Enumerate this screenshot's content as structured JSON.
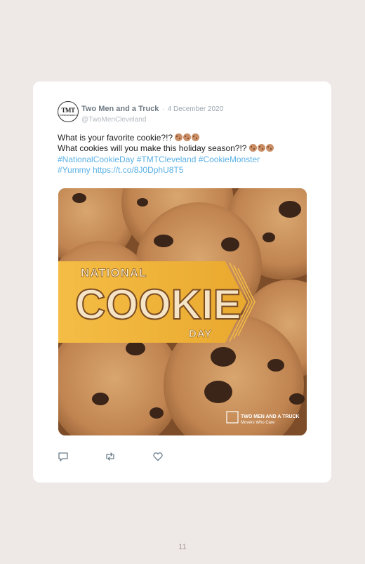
{
  "tweet": {
    "author_name": "Two Men and a Truck",
    "separator": "·",
    "date": "4 December 2020",
    "handle": "@TwoMenCleveland",
    "avatar_text": "TMT",
    "avatar_subtext": "TWO MEN AND A TRUCK",
    "text_line1": "What is your favorite cookie?!?",
    "text_line2": "What cookies will you make this holiday season?!?",
    "hashtag1": "#NationalCookieDay",
    "hashtag2": "#TMTCleveland",
    "hashtag3": "#CookieMonster",
    "hashtag4": "#Yummy",
    "short_link": "https://t.co/8J0DphU8T5",
    "emoji": "cookie-emoji"
  },
  "media": {
    "banner_line1": "NATIONAL",
    "banner_line2": "COOKIE",
    "banner_line3": "DAY",
    "watermark_brand": "TWO MEN AND A TRUCK",
    "watermark_tagline": "Movers Who Care",
    "colors": {
      "banner": "#f2b73d",
      "cookie": "#c98e5a",
      "chip": "#3b2418"
    }
  },
  "actions": {
    "reply": "reply-icon",
    "retweet": "retweet-icon",
    "like": "heart-icon"
  },
  "page": {
    "number": "11"
  }
}
